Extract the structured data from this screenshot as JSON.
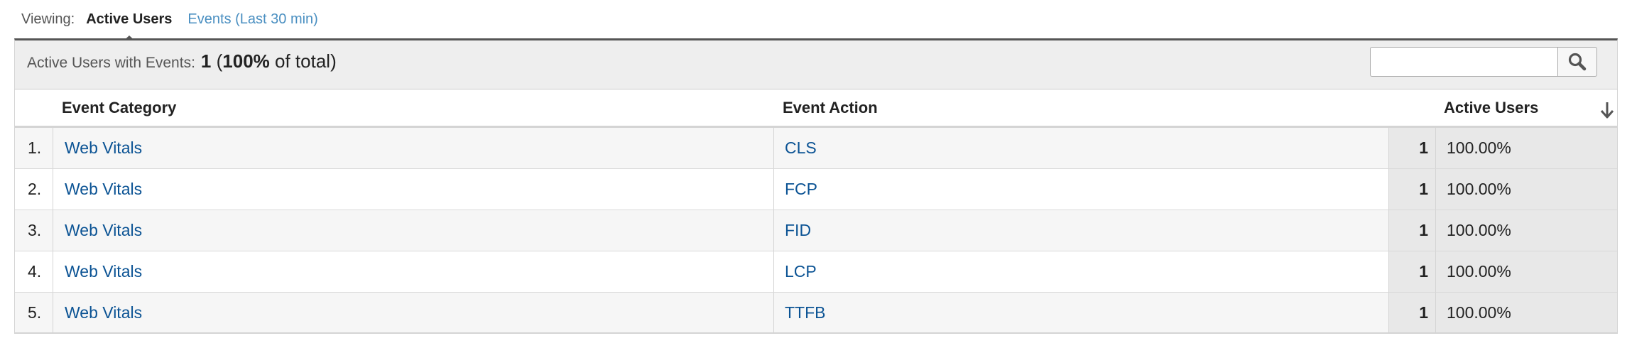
{
  "viewing": {
    "label": "Viewing:",
    "active_tab": "Active Users",
    "other_tab": "Events (Last 30 min)"
  },
  "summary": {
    "label": "Active Users with Events:",
    "count": "1",
    "open_paren": "(",
    "percent": "100%",
    "of_total": "of total)"
  },
  "search": {
    "placeholder": "",
    "icon": "search-icon"
  },
  "table": {
    "headers": {
      "category": "Event Category",
      "action": "Event Action",
      "users": "Active Users",
      "sort_icon": "sort-descending-arrow-icon"
    },
    "rows": [
      {
        "index": "1.",
        "category": "Web Vitals",
        "action": "CLS",
        "users": "1",
        "percent": "100.00%"
      },
      {
        "index": "2.",
        "category": "Web Vitals",
        "action": "FCP",
        "users": "1",
        "percent": "100.00%"
      },
      {
        "index": "3.",
        "category": "Web Vitals",
        "action": "FID",
        "users": "1",
        "percent": "100.00%"
      },
      {
        "index": "4.",
        "category": "Web Vitals",
        "action": "LCP",
        "users": "1",
        "percent": "100.00%"
      },
      {
        "index": "5.",
        "category": "Web Vitals",
        "action": "TTFB",
        "users": "1",
        "percent": "100.00%"
      }
    ]
  },
  "colors": {
    "link": "#0b5394",
    "tab_link": "#4a8fc1",
    "metric_bg": "#e8e8e8",
    "summary_bg": "#eeeeee"
  }
}
